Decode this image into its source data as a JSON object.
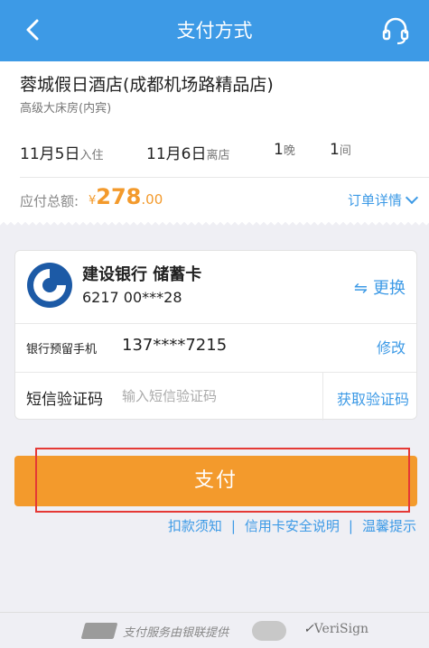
{
  "navbar": {
    "title": "支付方式",
    "back_icon": "chevron-left-icon",
    "support_icon": "headset-icon",
    "color": "#3d9ae6"
  },
  "order": {
    "hotel_name": "蓉城假日酒店(成都机场路精品店)",
    "room_type": "高级大床房(内宾)",
    "checkin_date": "11月5日",
    "checkin_label": "入住",
    "checkout_date": "11月6日",
    "checkout_label": "离店",
    "nights_value": "1",
    "nights_unit": "晚",
    "rooms_value": "1",
    "rooms_unit": "间",
    "total_label": "应付总额:",
    "currency": "¥",
    "total_integer": "278",
    "total_decimal": ".00",
    "detail_link": "订单详情",
    "price_color": "#f39a2c"
  },
  "payment_card": {
    "bank_name": "建设银行 储蓄卡",
    "card_number": "6217 00***28",
    "change_icon": "swap-arrows-icon",
    "change_label": "更换",
    "phone_label": "银行预留手机",
    "phone_value": "137****7215",
    "modify_label": "修改",
    "sms_label": "短信验证码",
    "sms_placeholder": "输入短信验证码",
    "get_code_label": "获取验证码"
  },
  "pay_button": {
    "label": "支付",
    "color": "#f39a2c"
  },
  "links": [
    {
      "label": "扣款须知"
    },
    {
      "label": "信用卡安全说明"
    },
    {
      "label": "温馨提示"
    }
  ],
  "links_separator": "|",
  "footer": {
    "unionpay_logo": "unionpay-logo",
    "unionpay_text": "支付服务由银联提供",
    "verisign_text": "VeriSign"
  }
}
